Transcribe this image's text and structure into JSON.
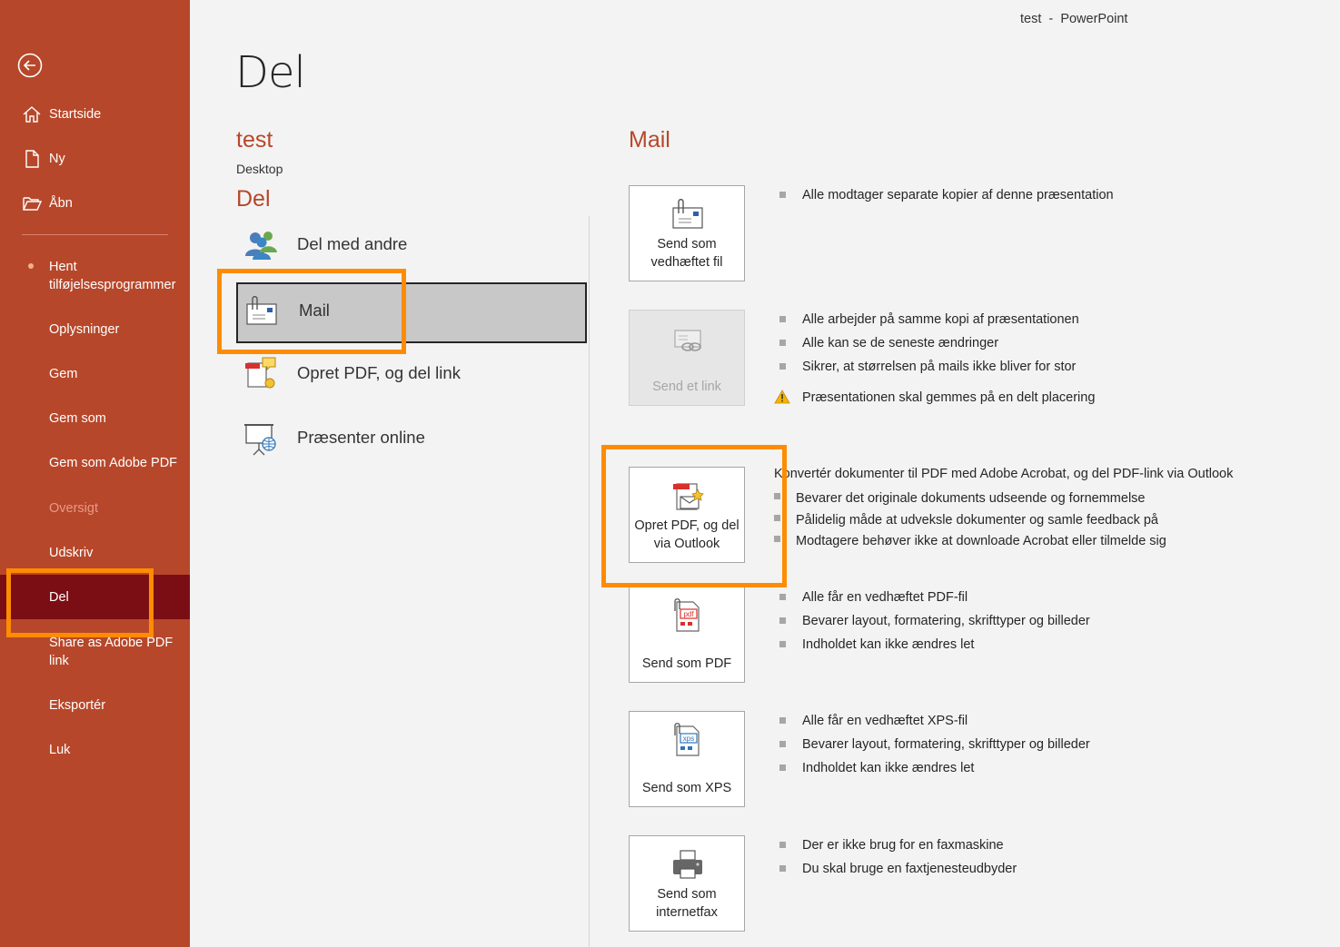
{
  "window": {
    "title": "test  -  PowerPoint"
  },
  "sidebar": {
    "back_label": "",
    "items": [
      {
        "label": "Startside",
        "icon": "home-icon"
      },
      {
        "label": "Ny",
        "icon": "new-document-icon"
      },
      {
        "label": "Åbn",
        "icon": "open-folder-icon"
      },
      {
        "label": "Hent tilføjelsesprogrammer"
      },
      {
        "label": "Oplysninger"
      },
      {
        "label": "Gem"
      },
      {
        "label": "Gem som"
      },
      {
        "label": "Gem som Adobe PDF"
      },
      {
        "label": "Oversigt",
        "disabled": true
      },
      {
        "label": "Udskriv"
      },
      {
        "label": "Del",
        "selected": true
      },
      {
        "label": "Share as Adobe PDF link"
      },
      {
        "label": "Eksportér"
      },
      {
        "label": "Luk"
      }
    ]
  },
  "main": {
    "page_title": "Del",
    "document": {
      "name": "test",
      "location": "Desktop"
    },
    "section_title": "Del",
    "share_options": [
      {
        "label": "Del med andre",
        "icon": "people-icon"
      },
      {
        "label": "Mail",
        "icon": "mail-attachment-icon",
        "selected": true
      },
      {
        "label": "Opret PDF, og del link",
        "icon": "pdf-share-icon"
      },
      {
        "label": "Præsenter online",
        "icon": "present-online-icon"
      }
    ]
  },
  "mail_panel": {
    "title": "Mail",
    "actions": [
      {
        "label": "Send som vedhæftet fil",
        "icon": "mail-attachment-icon",
        "bullets": [
          "Alle modtager separate kopier af denne præsentation"
        ]
      },
      {
        "label": "Send et link",
        "icon": "mail-link-icon",
        "disabled": true,
        "bullets": [
          "Alle arbejder på samme kopi af præsentationen",
          "Alle kan se de seneste ændringer",
          "Sikrer, at størrelsen på mails ikke bliver for stor"
        ],
        "warning": "Præsentationen skal gemmes på en delt placering"
      },
      {
        "label": "Opret PDF, og del via Outlook",
        "icon": "pdf-outlook-icon",
        "description": "Konvertér dokumenter til PDF med Adobe Acrobat, og del PDF-link via Outlook",
        "bullets": [
          "Bevarer det originale dokuments udseende og fornemmelse",
          "Pålidelig måde at udveksle dokumenter og samle feedback på",
          "Modtagere behøver ikke at downloade Acrobat eller tilmelde sig"
        ]
      },
      {
        "label": "Send som PDF",
        "icon": "pdf-file-icon",
        "bullets": [
          "Alle får en vedhæftet PDF-fil",
          "Bevarer layout, formatering, skrifttyper og billeder",
          "Indholdet kan ikke ændres let"
        ]
      },
      {
        "label": "Send som XPS",
        "icon": "xps-file-icon",
        "bullets": [
          "Alle får en vedhæftet XPS-fil",
          "Bevarer layout, formatering, skrifttyper og billeder",
          "Indholdet kan ikke ændres let"
        ]
      },
      {
        "label": "Send som internetfax",
        "icon": "fax-icon",
        "bullets": [
          "Der er ikke brug for en faxmaskine",
          "Du skal bruge en faxtjenesteudbyder"
        ]
      }
    ]
  },
  "colors": {
    "sidebar": "#b7472a",
    "sidebar_selected": "#7a0e14",
    "accent_text": "#b7472a",
    "highlight": "#ff8c00"
  }
}
